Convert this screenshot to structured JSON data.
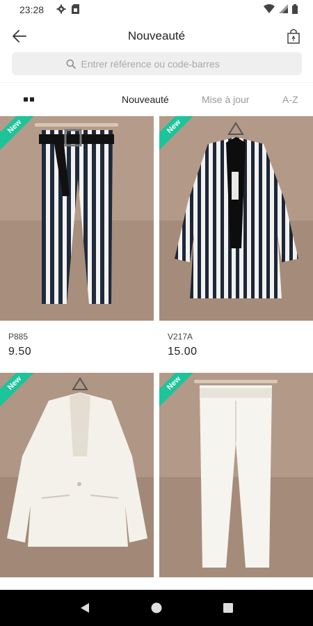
{
  "status_bar": {
    "time": "23:28",
    "left_icons": [
      "gear-icon",
      "sim-card-icon"
    ],
    "right_icons": [
      "wifi-icon",
      "signal-icon",
      "battery-icon"
    ]
  },
  "header": {
    "title": "Nouveauté",
    "back_icon": "back-arrow-icon",
    "bag_icon": "shopping-bag-icon"
  },
  "search": {
    "placeholder": "Entrer référence ou code-barres",
    "value": ""
  },
  "sort_tabs": [
    {
      "label": "Nouveauté",
      "active": true
    },
    {
      "label": "Mise à jour",
      "active": false
    },
    {
      "label": "A-Z",
      "active": false
    }
  ],
  "products": [
    {
      "badge": "New",
      "ref": "P885",
      "price": "9.50",
      "image": "striped-trousers"
    },
    {
      "badge": "New",
      "ref": "V217A",
      "price": "15.00",
      "image": "striped-blazer"
    },
    {
      "badge": "New",
      "ref": "",
      "price": "",
      "image": "white-blazer"
    },
    {
      "badge": "New",
      "ref": "",
      "price": "",
      "image": "white-trousers"
    }
  ],
  "nav_bar": {
    "buttons": [
      "back-triangle-icon",
      "home-circle-icon",
      "recents-square-icon"
    ]
  },
  "colors": {
    "accent_badge": "#1cc49a",
    "tab_active": "#222222",
    "tab_inactive": "#9a9a9a",
    "photo_background": "#b39a88"
  }
}
